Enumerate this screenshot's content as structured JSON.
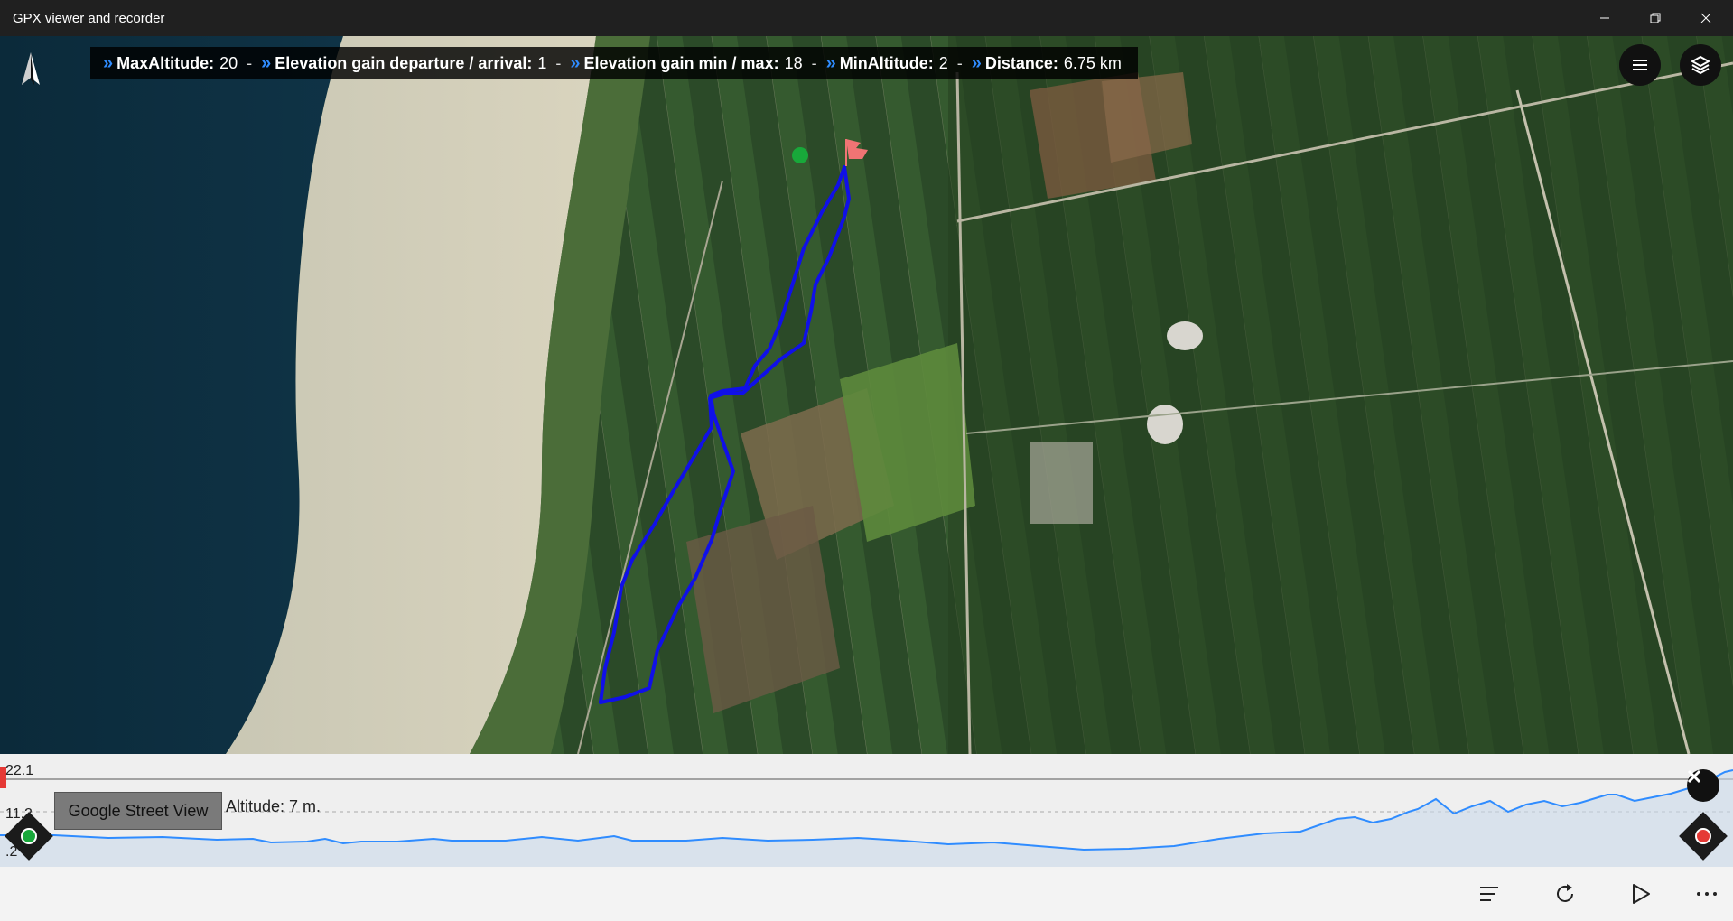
{
  "window": {
    "title": "GPX viewer and recorder"
  },
  "stats": [
    {
      "label": "MaxAltitude:",
      "value": "20"
    },
    {
      "label": "Elevation gain departure / arrival:",
      "value": "1"
    },
    {
      "label": "Elevation gain min / max:",
      "value": "18"
    },
    {
      "label": "MinAltitude:",
      "value": "2"
    },
    {
      "label": "Distance:",
      "value": "6.75 km"
    }
  ],
  "separator": "-",
  "elevation": {
    "y_max_label": "22.1",
    "y_mid_label": "11.2",
    "y_min_label": ".2",
    "street_view_button": "Google Street View",
    "altitude_readout": "Altitude: 7 m."
  },
  "icons": {
    "compass": "compass-icon",
    "menu": "hamburger-menu-icon",
    "layers": "layers-icon",
    "close": "close-icon",
    "list": "list-icon",
    "refresh": "refresh-icon",
    "play": "play-icon",
    "more": "more-icon"
  },
  "colors": {
    "track": "#1010e8",
    "profile_line": "#2f8cff",
    "accent_chevron": "#2f8cff",
    "start_marker": "#18a83a",
    "end_marker": "#e53935"
  }
}
